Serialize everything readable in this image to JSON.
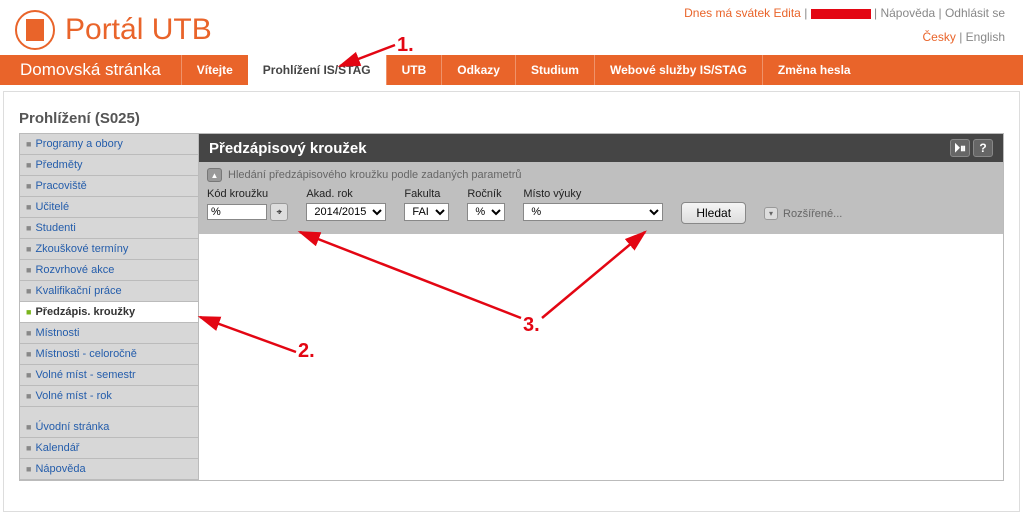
{
  "top": {
    "svatek": "Dnes má svátek Edita",
    "help": "Nápověda",
    "logout": "Odhlásit se",
    "lang_cs": "Česky",
    "lang_en": "English",
    "sep": " | "
  },
  "site_title": "Portál UTB",
  "nav": {
    "home": "Domovská stránka",
    "tabs": [
      {
        "label": "Vítejte",
        "active": false
      },
      {
        "label": "Prohlížení IS/STAG",
        "active": true
      },
      {
        "label": "UTB",
        "active": false
      },
      {
        "label": "Odkazy",
        "active": false
      },
      {
        "label": "Studium",
        "active": false
      },
      {
        "label": "Webové služby IS/STAG",
        "active": false
      },
      {
        "label": "Změna hesla",
        "active": false
      }
    ]
  },
  "page_title": "Prohlížení (S025)",
  "sidebar": {
    "group1": [
      "Programy a obory",
      "Předměty",
      "Pracoviště",
      "Učitelé",
      "Studenti",
      "Zkouškové termíny",
      "Rozvrhové akce",
      "Kvalifikační práce",
      "Předzápis. kroužky",
      "Místnosti",
      "Místnosti - celoročně",
      "Volné míst - semestr",
      "Volné míst - rok"
    ],
    "group2": [
      "Úvodní stránka",
      "Kalendář",
      "Nápověda"
    ],
    "active_index": 8
  },
  "panel": {
    "title": "Předzápisový kroužek",
    "hint": "Hledání předzápisového kroužku podle zadaných parametrů",
    "filters": {
      "kod_label": "Kód kroužku",
      "kod_value": "%",
      "rok_label": "Akad. rok",
      "rok_value": "2014/2015",
      "fakulta_label": "Fakulta",
      "fakulta_value": "FAI",
      "rocnik_label": "Ročník",
      "rocnik_value": "%",
      "misto_label": "Místo výuky",
      "misto_value": "%",
      "search_btn": "Hledat",
      "advanced": "Rozšířené..."
    }
  },
  "annotations": {
    "a1": "1.",
    "a2": "2.",
    "a3": "3."
  }
}
